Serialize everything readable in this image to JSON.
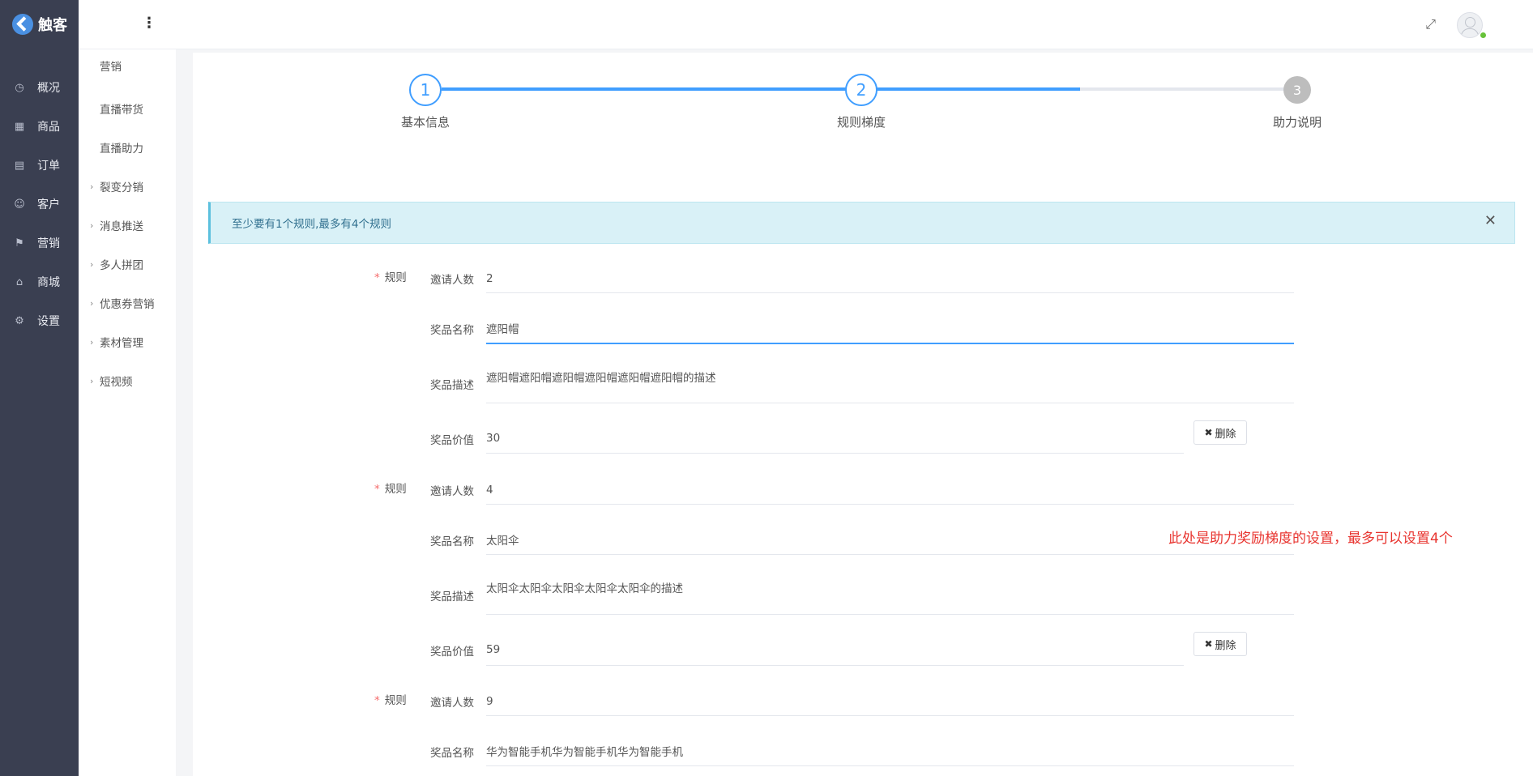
{
  "app": {
    "brand": "触客"
  },
  "nav": {
    "items": [
      {
        "label": "概况",
        "icon": "dashboard-icon",
        "glyph": "◷"
      },
      {
        "label": "商品",
        "icon": "grid-icon",
        "glyph": "▦"
      },
      {
        "label": "订单",
        "icon": "calendar-icon",
        "glyph": "▤"
      },
      {
        "label": "客户",
        "icon": "user-icon",
        "glyph": "☺"
      },
      {
        "label": "营销",
        "icon": "tag-icon",
        "glyph": "⚑"
      },
      {
        "label": "商城",
        "icon": "shop-icon",
        "glyph": "⌂"
      },
      {
        "label": "设置",
        "icon": "gear-icon",
        "glyph": "⚙"
      }
    ]
  },
  "subnav": {
    "items": [
      {
        "label": "营销",
        "arrow": ""
      },
      {
        "label": "直播带货",
        "arrow": ""
      },
      {
        "label": "直播助力",
        "arrow": ""
      },
      {
        "label": "裂变分销",
        "arrow": "›"
      },
      {
        "label": "消息推送",
        "arrow": "›"
      },
      {
        "label": "多人拼团",
        "arrow": "›"
      },
      {
        "label": "优惠券营销",
        "arrow": "›"
      },
      {
        "label": "素材管理",
        "arrow": "›"
      },
      {
        "label": "短视频",
        "arrow": "›"
      }
    ]
  },
  "steps": [
    {
      "num": "1",
      "title": "基本信息",
      "state": "done"
    },
    {
      "num": "2",
      "title": "规则梯度",
      "state": "active"
    },
    {
      "num": "3",
      "title": "助力说明",
      "state": "wait"
    }
  ],
  "alert": {
    "text": "至少要有1个规则,最多有4个规则",
    "close": "✕"
  },
  "form": {
    "rule_label": "规则",
    "required_mark": "*",
    "labels": {
      "invite": "邀请人数",
      "prize_name": "奖品名称",
      "prize_desc": "奖品描述",
      "prize_value": "奖品价值"
    },
    "delete_label": "删除",
    "delete_glyph": "✖",
    "rules": [
      {
        "invite": "2",
        "prize_name": "遮阳帽",
        "prize_desc": "遮阳帽遮阳帽遮阳帽遮阳帽遮阳帽遮阳帽的描述",
        "prize_value": "30"
      },
      {
        "invite": "4",
        "prize_name": "太阳伞",
        "prize_desc": "太阳伞太阳伞太阳伞太阳伞太阳伞的描述",
        "prize_value": "59"
      },
      {
        "invite": "9",
        "prize_name": "华为智能手机华为智能手机华为智能手机"
      }
    ]
  },
  "annotation": "此处是助力奖励梯度的设置，最多可以设置4个",
  "colors": {
    "primary": "#409eff",
    "nav_bg": "#3a3f51",
    "alert_bg": "#d9f1f7",
    "annotation": "#e8342f",
    "required": "#f56c6c"
  }
}
